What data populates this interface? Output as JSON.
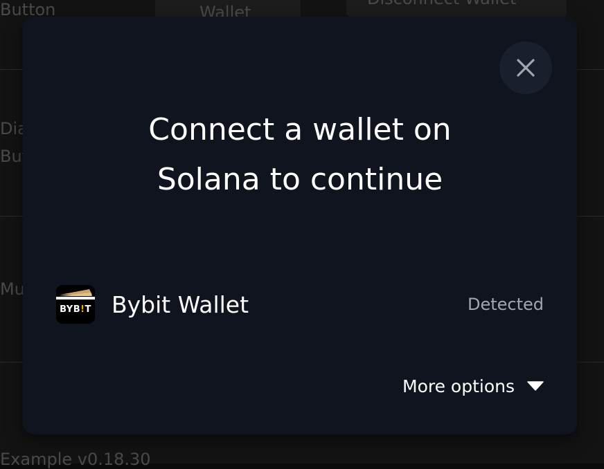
{
  "background": {
    "texts": [
      "Button",
      "Dia",
      "But",
      "Mu",
      "Example v0.18.30"
    ],
    "buttons": [
      "Wallet",
      "Disconnect Wallet"
    ]
  },
  "modal": {
    "title_line1": "Connect a wallet on",
    "title_line2": "Solana to continue",
    "close_icon": "close-icon",
    "wallets": [
      {
        "name": "Bybit Wallet",
        "status": "Detected",
        "logo_text": "BYB!T",
        "icon": "bybit-wallet-logo"
      }
    ],
    "more_options_label": "More options",
    "more_options_icon": "chevron-down-icon"
  },
  "colors": {
    "modal_bg": "#10141f",
    "close_bg": "#1a1f2e",
    "text_primary": "#ffffff",
    "text_muted": "#a2a6b0",
    "logo_accent": "#f7a600"
  }
}
